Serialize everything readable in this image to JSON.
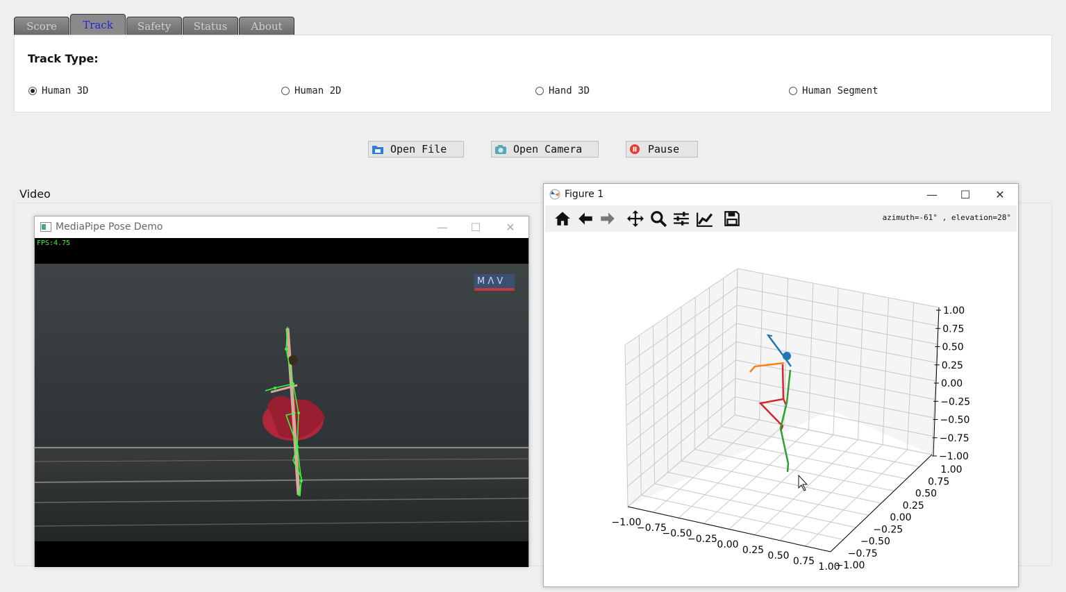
{
  "tabs": [
    {
      "label": "Score"
    },
    {
      "label": "Track"
    },
    {
      "label": "Safety"
    },
    {
      "label": "Status"
    },
    {
      "label": "About"
    }
  ],
  "active_tab": "Track",
  "track": {
    "title": "Track Type:",
    "options": [
      {
        "label": "Human 3D",
        "checked": true
      },
      {
        "label": "Human 2D",
        "checked": false
      },
      {
        "label": "Hand 3D",
        "checked": false
      },
      {
        "label": "Human Segment",
        "checked": false
      }
    ]
  },
  "buttons": {
    "open_file": "Open File",
    "open_camera": "Open Camera",
    "pause": "Pause"
  },
  "video_label": "Video",
  "pose_window": {
    "title": "MediaPipe Pose Demo",
    "fps": "FPS:4.75",
    "logo_text": "M Λ V"
  },
  "figure_window": {
    "title": "Figure 1",
    "status": "azimuth=-61° , elevation=28°"
  },
  "colors": {
    "active_tab_text": "#2222dd",
    "tab_bg": "#7a7a7a",
    "skeleton_blue": "#1f77b4",
    "skeleton_orange": "#ff7f0e",
    "skeleton_green": "#2ca02c",
    "skeleton_red": "#d62728",
    "overlay_green": "#33ff33"
  },
  "icons": [
    "home-icon",
    "back-arrow-icon",
    "forward-arrow-icon",
    "pan-icon",
    "zoom-icon",
    "configure-icon",
    "edit-axis-icon",
    "save-icon"
  ],
  "chart_data": {
    "type": "scatter3d",
    "x_ticks": [
      "−1.00",
      "−0.75",
      "−0.50",
      "−0.25",
      "0.00",
      "0.25",
      "0.50",
      "0.75",
      "1.00"
    ],
    "y_ticks": [
      "−1.00",
      "−0.75",
      "−0.50",
      "−0.25",
      "0.00",
      "0.25",
      "0.50",
      "0.75",
      "1.00"
    ],
    "z_ticks": [
      "1.00",
      "0.75",
      "0.50",
      "0.25",
      "0.00",
      "−0.25",
      "−0.50",
      "−0.75",
      "−1.00"
    ],
    "xlim": [
      -1,
      1
    ],
    "ylim": [
      -1,
      1
    ],
    "zlim": [
      -1,
      1
    ],
    "grid": true
  }
}
